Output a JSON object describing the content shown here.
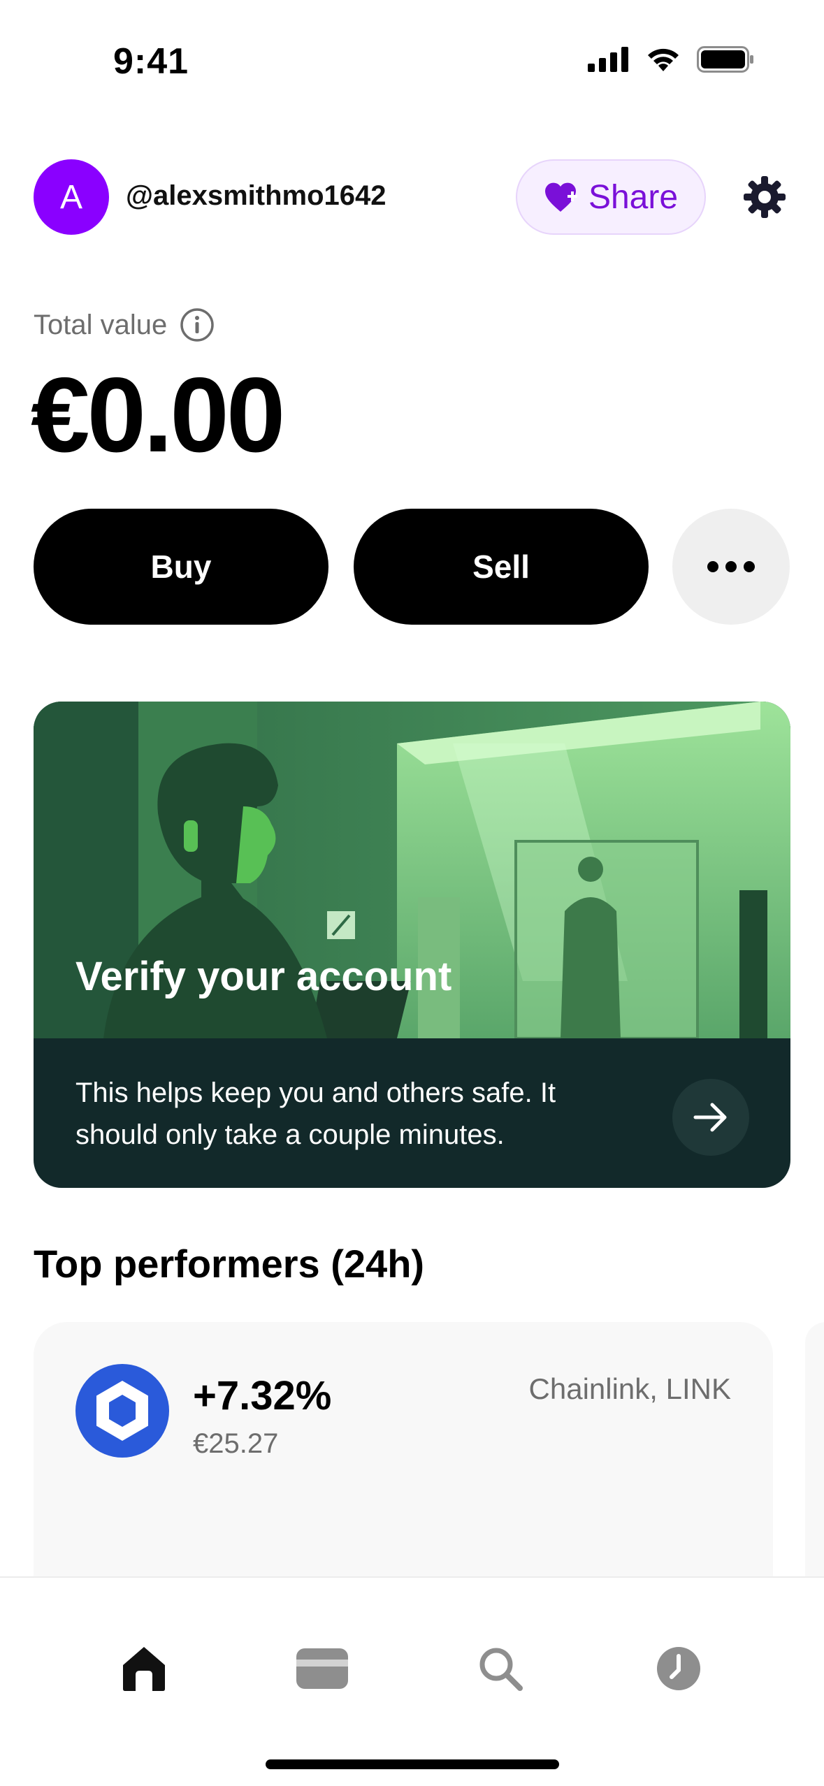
{
  "status_bar": {
    "time": "9:41",
    "icons": [
      "cellular-signal-icon",
      "wifi-icon",
      "battery-icon"
    ]
  },
  "header": {
    "avatar_initial": "A",
    "username": "@alexsmithmo1642",
    "share_label": "Share",
    "share_icon": "heart-plus-icon",
    "settings_icon": "gear-icon"
  },
  "portfolio": {
    "total_label": "Total value",
    "total_value": "€0.00"
  },
  "actions": {
    "buy_label": "Buy",
    "sell_label": "Sell",
    "more_icon": "more-dots-icon"
  },
  "verify_card": {
    "title": "Verify your account",
    "description": "This helps keep you and others safe. It should only take a couple minutes.",
    "arrow_icon": "arrow-right-icon"
  },
  "top_performers": {
    "section_title": "Top performers (24h)",
    "items": [
      {
        "change": "+7.32%",
        "price": "€25.27",
        "name": "Chainlink, LINK",
        "logo_icon": "chainlink-logo-icon"
      }
    ]
  },
  "tab_bar": {
    "tabs": [
      {
        "icon": "home-icon",
        "active": true
      },
      {
        "icon": "card-icon",
        "active": false
      },
      {
        "icon": "search-icon",
        "active": false
      },
      {
        "icon": "clock-icon",
        "active": false
      }
    ]
  },
  "colors": {
    "accent_purple": "#8a00ff",
    "share_text": "#7a10d8",
    "verify_card_bg": "#12292a",
    "chainlink_blue": "#2a5ada"
  }
}
